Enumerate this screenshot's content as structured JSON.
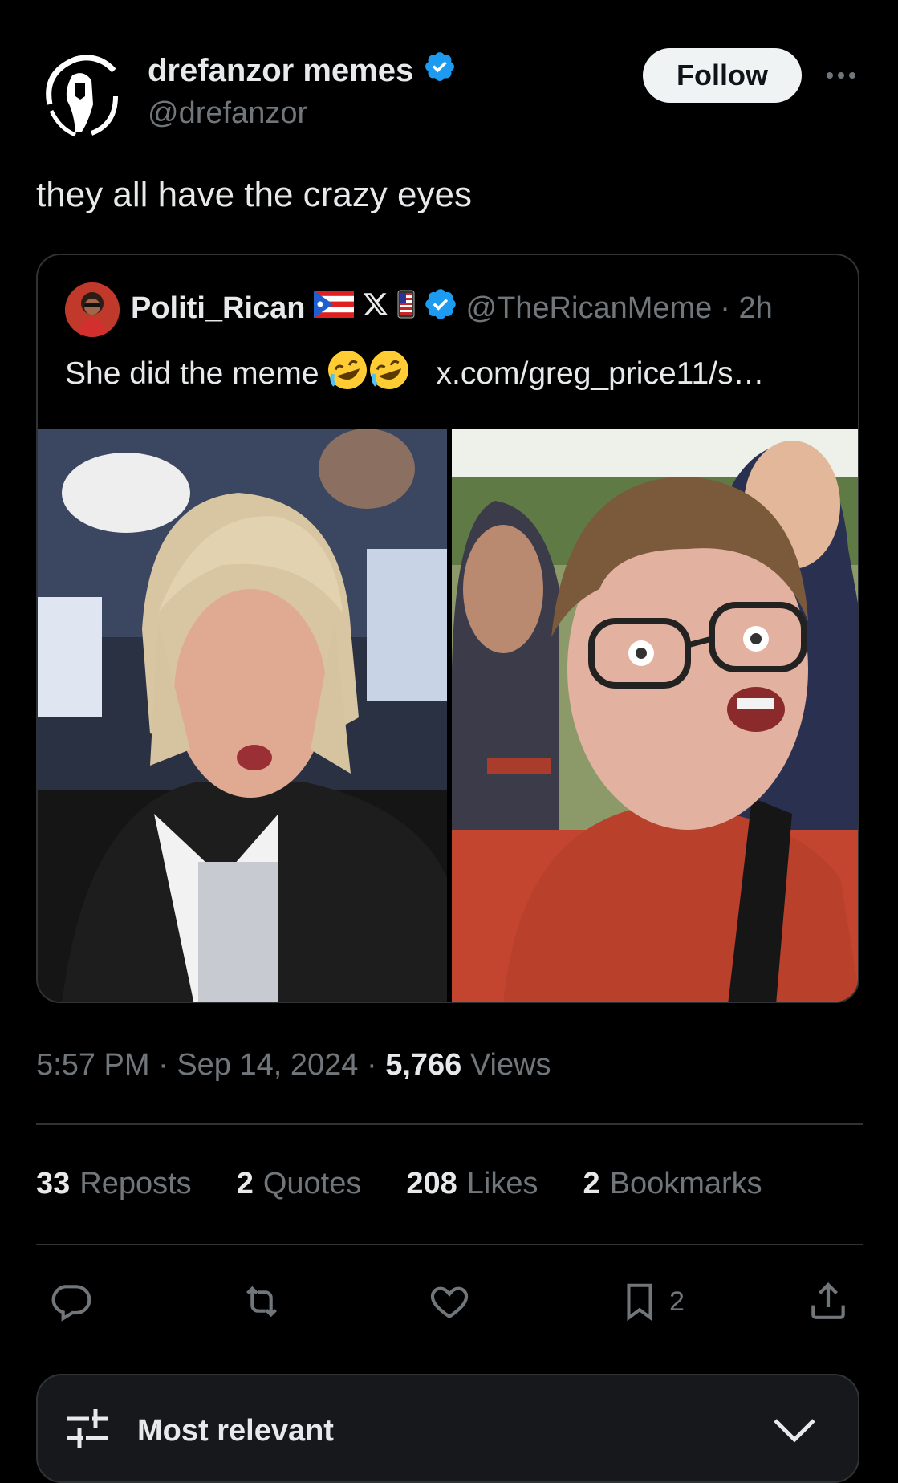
{
  "author": {
    "display_name": "drefanzor memes",
    "handle": "@drefanzor",
    "verified": true
  },
  "actions": {
    "follow_label": "Follow"
  },
  "tweet_text": "they all have the crazy eyes",
  "quoted_tweet": {
    "display_name": "Politi_Rican",
    "name_emojis": [
      "puerto-rico-flag",
      "x-logo",
      "us-flag-phone"
    ],
    "verified": true,
    "handle": "@TheRicanMeme",
    "time": "· 2h",
    "text": "She did the meme",
    "emojis": "🤣🤣",
    "link": "x.com/greg_price11/s…",
    "media": [
      "blonde-woman-talking-photo",
      "woman-with-glasses-yelling-photo"
    ]
  },
  "meta": {
    "time": "5:57 PM",
    "sep1": "·",
    "date": "Sep 14, 2024",
    "sep2": "·",
    "views_count": "5,766",
    "views_label": "Views"
  },
  "stats": {
    "reposts_count": "33",
    "reposts_label": "Reposts",
    "quotes_count": "2",
    "quotes_label": "Quotes",
    "likes_count": "208",
    "likes_label": "Likes",
    "bookmarks_count": "2",
    "bookmarks_label": "Bookmarks"
  },
  "action_bar": {
    "bookmark_count": "2"
  },
  "sort": {
    "label": "Most relevant"
  },
  "colors": {
    "background": "#000000",
    "verified": "#1d9bf0",
    "muted": "#71767b",
    "border": "#2f3336"
  }
}
